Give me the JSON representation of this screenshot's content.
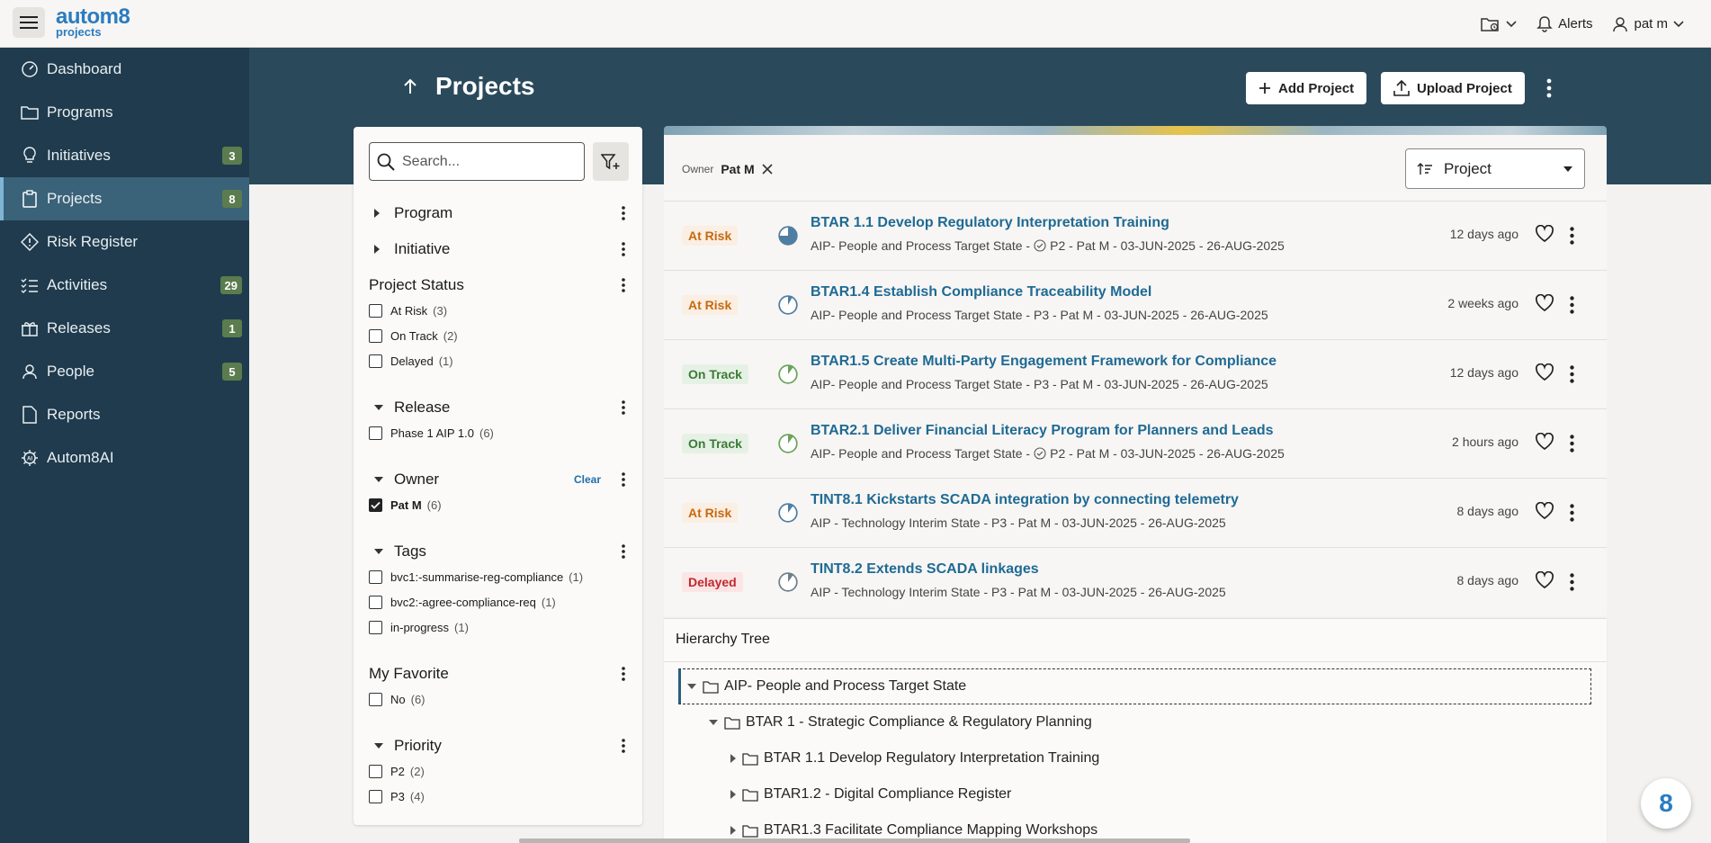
{
  "app": {
    "logo_line1": "autom8",
    "logo_line2": "projects",
    "alerts_label": "Alerts",
    "user_label": "pat m"
  },
  "sidebar": {
    "items": [
      {
        "label": "Dashboard",
        "icon": "dashboard-icon"
      },
      {
        "label": "Programs",
        "icon": "folder-icon"
      },
      {
        "label": "Initiatives",
        "icon": "lightbulb-icon",
        "badge": "3"
      },
      {
        "label": "Projects",
        "icon": "clipboard-icon",
        "badge": "8",
        "active": true
      },
      {
        "label": "Risk Register",
        "icon": "diamond-warning-icon"
      },
      {
        "label": "Activities",
        "icon": "checklist-icon",
        "badge": "29"
      },
      {
        "label": "Releases",
        "icon": "gift-icon",
        "badge": "1"
      },
      {
        "label": "People",
        "icon": "person-icon",
        "badge": "5"
      },
      {
        "label": "Reports",
        "icon": "document-icon"
      },
      {
        "label": "Autom8AI",
        "icon": "ai-gear-icon"
      }
    ]
  },
  "header": {
    "title": "Projects",
    "add_project": "Add Project",
    "upload_project": "Upload Project"
  },
  "filters": {
    "search_placeholder": "Search...",
    "clear_label": "Clear",
    "program": "Program",
    "initiative": "Initiative",
    "project_status": {
      "title": "Project Status",
      "options": [
        {
          "label": "At Risk",
          "count": "(3)"
        },
        {
          "label": "On Track",
          "count": "(2)"
        },
        {
          "label": "Delayed",
          "count": "(1)"
        }
      ]
    },
    "release": {
      "title": "Release",
      "options": [
        {
          "label": "Phase 1 AIP 1.0",
          "count": "(6)"
        }
      ]
    },
    "owner": {
      "title": "Owner",
      "options": [
        {
          "label": "Pat M",
          "count": "(6)",
          "checked": true
        }
      ]
    },
    "tags": {
      "title": "Tags",
      "options": [
        {
          "label": "bvc1:-summarise-reg-compliance",
          "count": "(1)"
        },
        {
          "label": "bvc2:-agree-compliance-req",
          "count": "(1)"
        },
        {
          "label": "in-progress",
          "count": "(1)"
        }
      ]
    },
    "favorite": {
      "title": "My Favorite",
      "options": [
        {
          "label": "No",
          "count": "(6)"
        }
      ]
    },
    "priority": {
      "title": "Priority",
      "options": [
        {
          "label": "P2",
          "count": "(2)"
        },
        {
          "label": "P3",
          "count": "(4)"
        }
      ]
    }
  },
  "list": {
    "owner_key": "Owner",
    "owner_value": "Pat M",
    "sort_label": "Project",
    "projects": [
      {
        "status": "At Risk",
        "kind": "risk",
        "title": "BTAR 1.1 Develop Regulatory Interpretation Training",
        "sub_a": "AIP- People and Process Target State -",
        "sub_b": "P2 - Pat M - 03-JUN-2025 - 26-AUG-2025",
        "when": "12 days ago",
        "progress": 0.75
      },
      {
        "status": "At Risk",
        "kind": "risk",
        "title": "BTAR1.4 Establish Compliance Traceability Model",
        "sub_a": "AIP- People and Process Target State - P3 - Pat M - 03-JUN-2025 - 26-AUG-2025",
        "sub_b": "",
        "when": "2 weeks ago",
        "progress": 0.08
      },
      {
        "status": "On Track",
        "kind": "ok",
        "title": "BTAR1.5 Create Multi-Party Engagement Framework for Compliance",
        "sub_a": "AIP- People and Process Target State - P3 - Pat M - 03-JUN-2025 - 26-AUG-2025",
        "sub_b": "",
        "when": "12 days ago",
        "progress": 0.1
      },
      {
        "status": "On Track",
        "kind": "ok",
        "title": "BTAR2.1 Deliver Financial Literacy Program for Planners and Leads",
        "sub_a": "AIP- People and Process Target State -",
        "sub_b": "P2 - Pat M - 03-JUN-2025 - 26-AUG-2025",
        "when": "2 hours ago",
        "progress": 0.1
      },
      {
        "status": "At Risk",
        "kind": "risk",
        "title": "TINT8.1 Kickstarts SCADA integration by connecting telemetry",
        "sub_a": "AIP - Technology Interim State - P3 - Pat M - 03-JUN-2025 - 26-AUG-2025",
        "sub_b": "",
        "when": "8 days ago",
        "progress": 0.1
      },
      {
        "status": "Delayed",
        "kind": "delay",
        "title": "TINT8.2 Extends SCADA linkages",
        "sub_a": "AIP - Technology Interim State - P3 - Pat M - 03-JUN-2025 - 26-AUG-2025",
        "sub_b": "",
        "when": "8 days ago",
        "progress": 0.1
      }
    ]
  },
  "tree": {
    "title": "Hierarchy Tree",
    "nodes": [
      {
        "label": "AIP- People and Process Target State",
        "level": 0,
        "open": true,
        "selected": true
      },
      {
        "label": "BTAR 1 - Strategic Compliance & Regulatory Planning",
        "level": 1,
        "open": true
      },
      {
        "label": "BTAR 1.1 Develop Regulatory Interpretation Training",
        "level": 2,
        "open": false
      },
      {
        "label": "BTAR1.2 - Digital Compliance Register",
        "level": 2,
        "open": false
      },
      {
        "label": "BTAR1.3 Facilitate Compliance Mapping Workshops",
        "level": 2,
        "open": false
      }
    ]
  },
  "colors": {
    "sidebar": "#1f3b4d",
    "sidebar_active": "#3a6278",
    "header_band": "#2a4a5c",
    "link": "#1f6a94",
    "at_risk": "#c66a10",
    "on_track": "#3c7a36",
    "delayed": "#c0282d"
  },
  "help_button": "8"
}
